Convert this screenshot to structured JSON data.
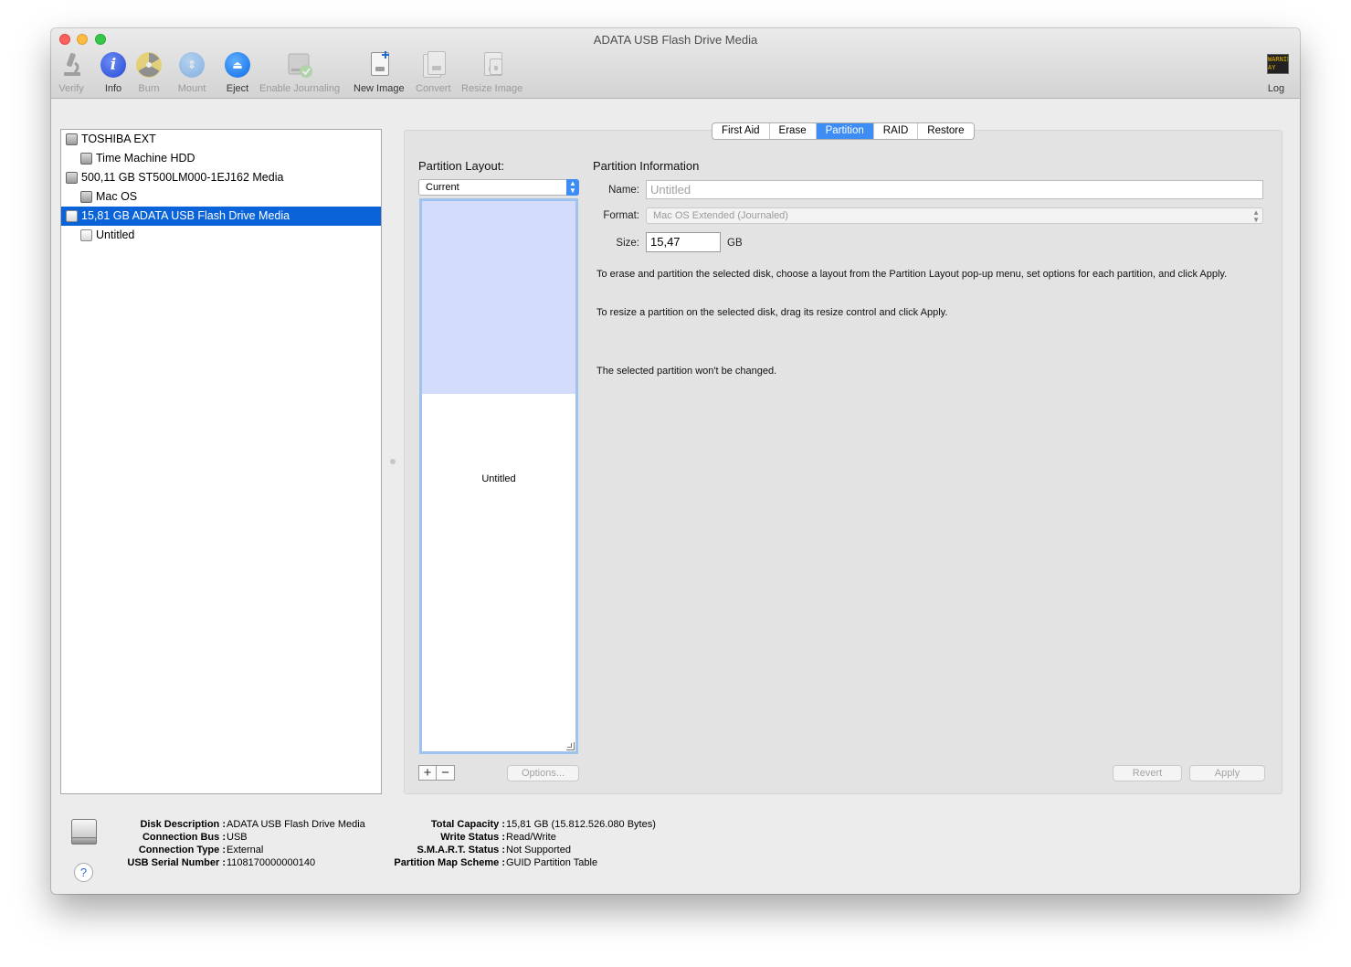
{
  "window": {
    "title": "ADATA USB Flash Drive Media"
  },
  "toolbar": {
    "items": [
      {
        "label": "Verify"
      },
      {
        "label": "Info"
      },
      {
        "label": "Burn"
      },
      {
        "label": "Mount"
      },
      {
        "label": "Eject"
      },
      {
        "label": "Enable Journaling"
      },
      {
        "label": "New Image"
      },
      {
        "label": "Convert"
      },
      {
        "label": "Resize Image"
      }
    ],
    "log": {
      "label": "Log",
      "screen_line1": "WARNIN",
      "screen_line2": "AY 7:36"
    }
  },
  "sidebar": {
    "items": [
      {
        "label": "TOSHIBA EXT"
      },
      {
        "label": "Time Machine HDD"
      },
      {
        "label": "500,11 GB ST500LM000-1EJ162 Media"
      },
      {
        "label": "Mac OS"
      },
      {
        "label": "15,81 GB ADATA USB Flash Drive Media"
      },
      {
        "label": "Untitled"
      }
    ]
  },
  "tabs": [
    {
      "label": "First Aid"
    },
    {
      "label": "Erase"
    },
    {
      "label": "Partition"
    },
    {
      "label": "RAID"
    },
    {
      "label": "Restore"
    }
  ],
  "partition_layout": {
    "heading": "Partition Layout:",
    "selected": "Current",
    "partition_label": "Untitled",
    "add_label": "+",
    "remove_label": "−",
    "options_label": "Options..."
  },
  "partition_info": {
    "heading": "Partition Information",
    "name_label": "Name:",
    "name_placeholder": "Untitled",
    "format_label": "Format:",
    "format_value": "Mac OS Extended (Journaled)",
    "size_label": "Size:",
    "size_value": "15,47",
    "size_unit": "GB",
    "help_text_1": "To erase and partition the selected disk, choose a layout from the Partition Layout pop-up menu, set options for each partition, and click Apply.",
    "help_text_2": "To resize a partition on the selected disk, drag its resize control and click Apply.",
    "status_text": "The selected partition won't be changed.",
    "revert_label": "Revert",
    "apply_label": "Apply"
  },
  "footer": {
    "disk_description_label": "Disk Description :",
    "disk_description": "ADATA USB Flash Drive Media",
    "connection_bus_label": "Connection Bus :",
    "connection_bus": "USB",
    "connection_type_label": "Connection Type :",
    "connection_type": "External",
    "usb_serial_label": "USB Serial Number :",
    "usb_serial": "1108170000000140",
    "total_capacity_label": "Total Capacity :",
    "total_capacity": "15,81 GB (15.812.526.080 Bytes)",
    "write_status_label": "Write Status :",
    "write_status": "Read/Write",
    "smart_status_label": "S.M.A.R.T. Status :",
    "smart_status": "Not Supported",
    "partition_map_label": "Partition Map Scheme :",
    "partition_map": "GUID Partition Table",
    "help_label": "?"
  },
  "colors": {
    "selection": "#0a63d8",
    "accent": "#3d8df5",
    "partition_fill": "#d4dcfc"
  }
}
